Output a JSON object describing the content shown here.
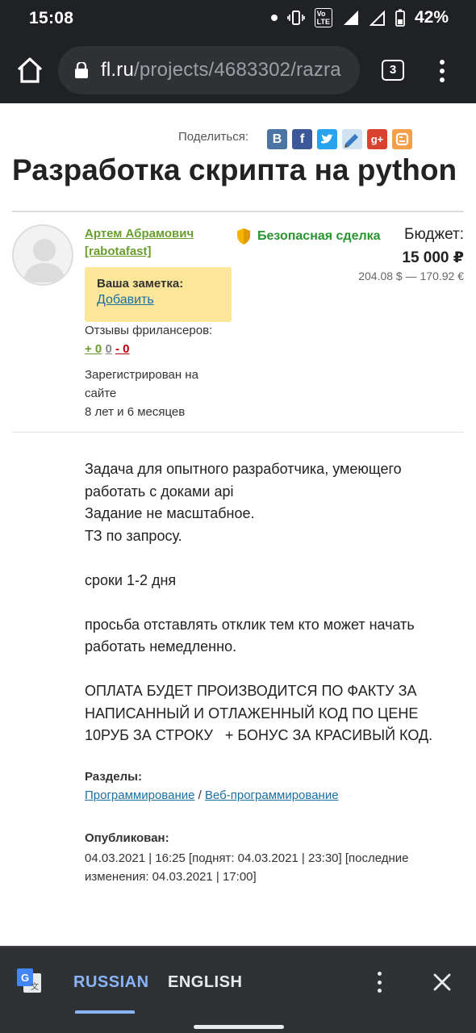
{
  "status_bar": {
    "time": "15:08",
    "battery": "42%",
    "network": "LTE+"
  },
  "browser": {
    "url_domain": "fl.ru",
    "url_path": "/projects/4683302/razra",
    "tab_count": "3"
  },
  "share": {
    "label": "Поделиться:",
    "icons": [
      "vk-icon",
      "facebook-icon",
      "twitter-icon",
      "bookmark-icon",
      "google-plus-icon",
      "blogger-icon"
    ]
  },
  "project": {
    "title": "Разработка скрипта на python"
  },
  "employer": {
    "name": "Артем Абрамович",
    "login": "[rabotafast]",
    "note_label": "Ваша заметка:",
    "note_add": "Добавить",
    "reviews_label": "Отзывы фрилансеров:",
    "reviews_positive": "+ 0",
    "reviews_neutral": "0",
    "reviews_negative": "- 0",
    "registered_line1": "Зарегистрирован на сайте",
    "registered_line2": "8 лет и 6 месяцев"
  },
  "deal": {
    "safe_label": "Безопасная сделка",
    "budget_label": "Бюджет:",
    "budget_value": "15 000 ₽",
    "budget_converted": "204.08 $ — 170.92 €"
  },
  "description": {
    "lines": [
      "Задача для опытного разработчика, умеющего работать с доками api",
      "Задание не масштабное.",
      "ТЗ по запросу.",
      "",
      "сроки 1-2 дня",
      "",
      "просьба отставлять отклик тем кто может начать работать немедленно.",
      "",
      "ОПЛАТА БУДЕТ ПРОИЗВОДИТСЯ ПО ФАКТУ ЗА НАПИСАННЫЙ И ОТЛАЖЕННЫЙ КОД ПО ЦЕНЕ 10РУБ ЗА СТРОКУ   + БОНУС ЗА КРАСИВЫЙ КОД."
    ]
  },
  "sections": {
    "label": "Разделы:",
    "primary": "Программирование",
    "separator": "/",
    "secondary": "Веб-программирование"
  },
  "published": {
    "label": "Опубликован:",
    "text": "04.03.2021 | 16:25 [поднят: 04.03.2021 | 23:30] [последние изменения: 04.03.2021 | 17:00]"
  },
  "translate_bar": {
    "source_lang": "RUSSIAN",
    "target_lang": "ENGLISH"
  },
  "colors": {
    "chrome_dark": "#202124",
    "url_box": "#303134",
    "author_green": "#6a9f2f",
    "safe_green": "#28962f",
    "link_blue": "#1a6fa3",
    "note_yellow": "#fbe69a",
    "negative_red": "#b8000b",
    "translate_active": "#8ab4f8"
  }
}
